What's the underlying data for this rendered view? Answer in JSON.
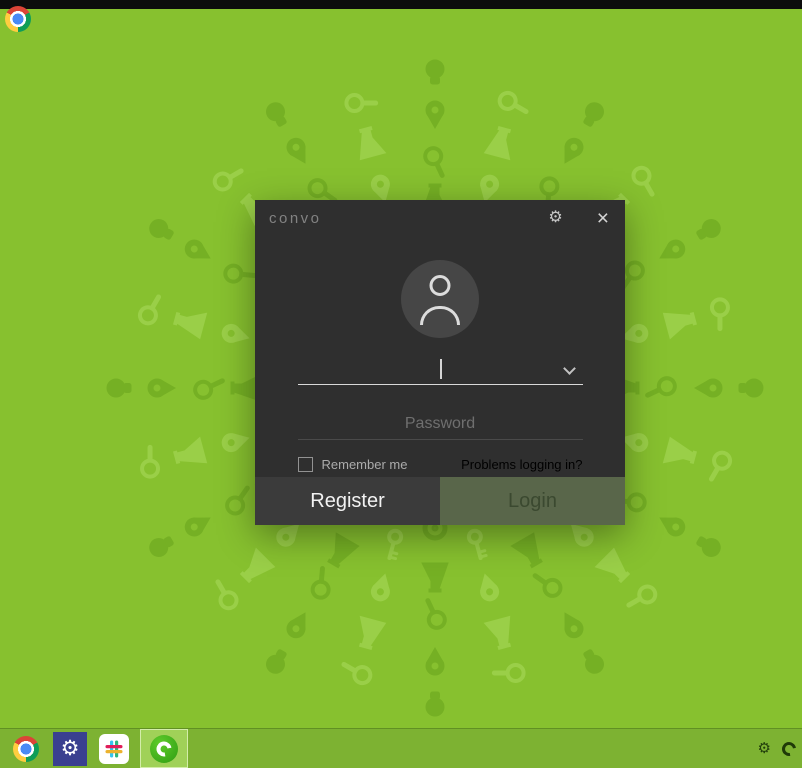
{
  "desktop": {
    "background_color": "#87c12f",
    "pattern_color_dark": "#68a31c",
    "pattern_color_light": "#aede63"
  },
  "login_window": {
    "title": "convo",
    "username_value": "",
    "username_placeholder": "",
    "password_placeholder": "Password",
    "remember_me_label": "Remember me",
    "problems_link": "Problems logging in?",
    "register_label": "Register",
    "login_label": "Login",
    "link_color": "#3f9ed9",
    "dialog_background": "#2f2f2f"
  },
  "icons": {
    "gear": "⚙",
    "close": "×",
    "chevron_down": "chevron-down",
    "avatar": "person-silhouette",
    "taskbar": [
      "chrome",
      "settings",
      "slack",
      "convo"
    ],
    "tray": [
      "gear",
      "convo"
    ]
  }
}
